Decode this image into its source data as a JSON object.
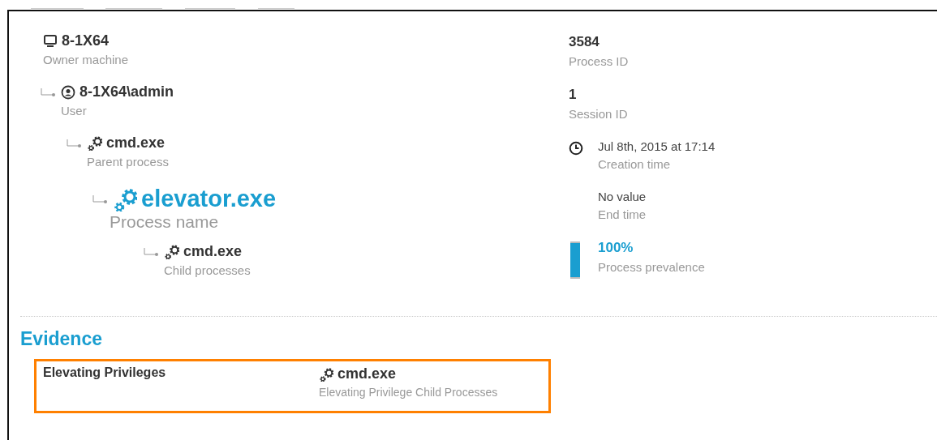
{
  "tree": {
    "kind": "machine",
    "value": "8-1X64",
    "label": "Owner machine",
    "children": [
      {
        "kind": "user",
        "value": "8-1X64\\admin",
        "label": "User",
        "children": [
          {
            "kind": "process",
            "value": "cmd.exe",
            "label": "Parent process",
            "children": [
              {
                "kind": "current",
                "value": "elevator.exe",
                "label": "Process name",
                "children": [
                  {
                    "kind": "process",
                    "value": "cmd.exe",
                    "label": "Child processes"
                  }
                ]
              }
            ]
          }
        ]
      }
    ]
  },
  "details": [
    {
      "kind": "number",
      "value": "3584",
      "label": "Process ID"
    },
    {
      "kind": "number",
      "value": "1",
      "label": "Session ID"
    },
    {
      "kind": "time",
      "value": "Jul 8th, 2015 at 17:14",
      "label": "Creation time"
    },
    {
      "kind": "text",
      "value": "No value",
      "label": "End time"
    },
    {
      "kind": "prevalence",
      "value": "100%",
      "label": "Process prevalence",
      "level": 1
    }
  ],
  "evidence": {
    "title": "Evidence",
    "items": [
      {
        "name": "Elevating Privileges",
        "value": "cmd.exe",
        "label": "Elevating Privilege Child Processes"
      }
    ]
  }
}
